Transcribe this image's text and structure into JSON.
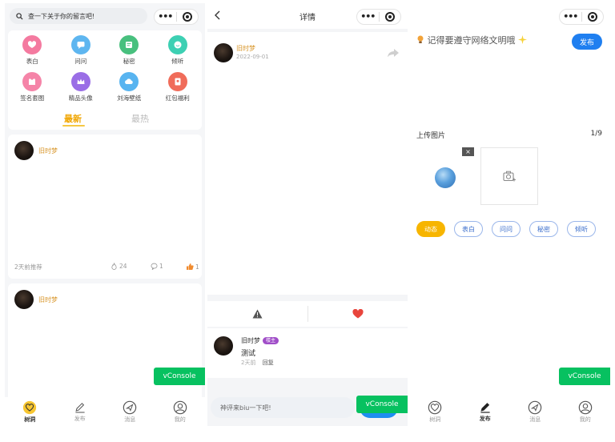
{
  "screen1": {
    "search_placeholder": "查一下关于你的留言吧!",
    "categories": [
      {
        "label": "表白",
        "icon": "heart-icon",
        "color": "#f47aa0"
      },
      {
        "label": "问问",
        "icon": "chat-icon",
        "color": "#5eb6f0"
      },
      {
        "label": "秘密",
        "icon": "secret-icon",
        "color": "#48c07e"
      },
      {
        "label": "倾听",
        "icon": "listen-icon",
        "color": "#3dd0b3"
      },
      {
        "label": "签名套图",
        "icon": "gallery-icon",
        "color": "#f584a8"
      },
      {
        "label": "精品头像",
        "icon": "crown-icon",
        "color": "#9a6ee6"
      },
      {
        "label": "刘海壁纸",
        "icon": "cloud-icon",
        "color": "#58b4f0"
      },
      {
        "label": "红包福利",
        "icon": "redpacket-icon",
        "color": "#f06c5a"
      }
    ],
    "tab_latest": "最新",
    "tab_hot": "最热",
    "posts": [
      {
        "author": "旧时梦",
        "time": "2天前推荐",
        "views": "24",
        "comments": "1",
        "likes": "1"
      },
      {
        "author": "旧时梦"
      }
    ],
    "vconsole_label": "vConsole"
  },
  "screen2": {
    "title": "详情",
    "author": "旧时梦",
    "date": "2022-09-01",
    "comment": {
      "author": "旧时梦",
      "badge": "楼主",
      "text": "测试",
      "time": "2天前",
      "reply": "回复"
    },
    "input_placeholder": "神评来biu一下吧!",
    "vconsole_label": "vConsole"
  },
  "screen3": {
    "notice": "记得要遵守网络文明哦",
    "publish_label": "发布",
    "upload_label": "上传图片",
    "upload_count": "1/9",
    "delete_label": "×",
    "chips": [
      "动态",
      "表白",
      "问问",
      "秘密",
      "倾听"
    ],
    "vconsole_label": "vConsole"
  },
  "tabbar": [
    "树洞",
    "发布",
    "消息",
    "我的"
  ],
  "colors": {
    "accent": "#f7b500",
    "primary": "#1f7ff0",
    "vconsole": "#07c160",
    "author": "#d8962a"
  }
}
